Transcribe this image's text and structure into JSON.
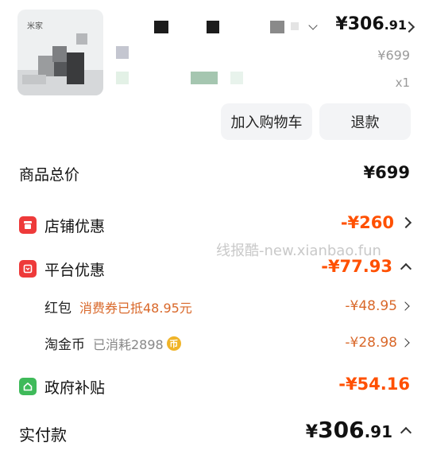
{
  "product": {
    "thumbnail_brand": "米家",
    "price_main": "¥306",
    "price_decimal": ".91",
    "original_price": "¥699",
    "quantity": "x1",
    "buttons": {
      "add_to_cart": "加入购物车",
      "refund": "退款"
    }
  },
  "summary": {
    "goods_total_label": "商品总价",
    "goods_total_value": "¥699",
    "store_discount_label": "店铺优惠",
    "store_discount_value": "-¥260",
    "platform_discount_label": "平台优惠",
    "platform_discount_value": "-¥77.93",
    "red_packet": {
      "label": "红包",
      "note": "消费券已抵48.95元",
      "value": "-¥48.95"
    },
    "taojinbi": {
      "label": "淘金币",
      "note": "已消耗2898",
      "coin_glyph": "币",
      "value": "-¥28.98"
    },
    "gov_subsidy_label": "政府补贴",
    "gov_subsidy_value": "-¥54.16",
    "paid_label": "实付款",
    "paid_currency": "¥",
    "paid_main": "306",
    "paid_decimal": ".91"
  },
  "watermark": "线报酷-new.xianbao.fun",
  "colors": {
    "accent_red": "#ff5000",
    "discount_orange": "#d9682a",
    "icon_red": "#ee3a3a",
    "icon_green": "#3fba5a",
    "coin_gold": "#f0b429"
  }
}
